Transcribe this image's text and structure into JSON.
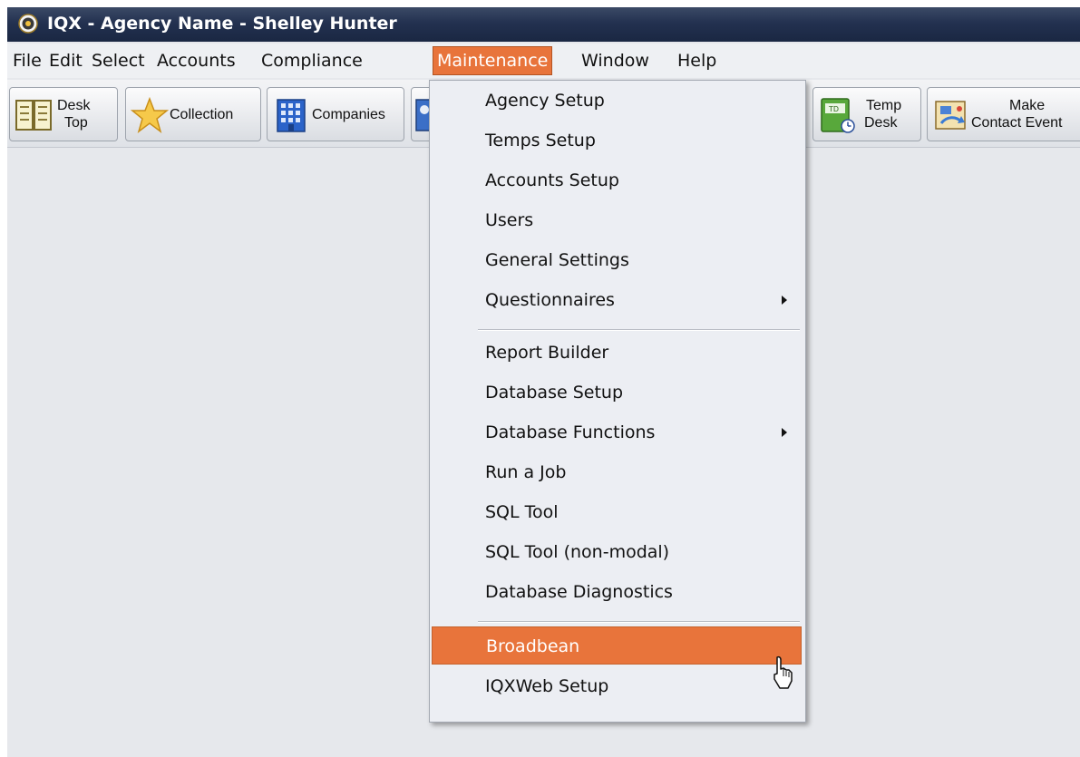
{
  "window": {
    "title": "IQX - Agency Name - Shelley Hunter"
  },
  "menubar": {
    "items": [
      "File",
      "Edit",
      "Select",
      "Accounts",
      "Compliance",
      "Maintenance",
      "Window",
      "Help"
    ],
    "active": "Maintenance"
  },
  "toolbar": {
    "desktop": {
      "line1": "Desk",
      "line2": "Top"
    },
    "collection": {
      "label": "Collection"
    },
    "companies": {
      "label": "Companies"
    },
    "temp_desk": {
      "line1": "Temp",
      "line2": "Desk",
      "icon_text": "TD"
    },
    "make_contact": {
      "line1": "Make",
      "line2": "Contact Event"
    }
  },
  "maintenance_menu": {
    "items": [
      {
        "label": "Agency Setup"
      },
      {
        "label": "Temps Setup"
      },
      {
        "label": "Accounts Setup"
      },
      {
        "label": "Users"
      },
      {
        "label": "General Settings"
      },
      {
        "label": "Questionnaires",
        "submenu": true
      },
      {
        "label": "Report Builder"
      },
      {
        "label": "Database Setup"
      },
      {
        "label": "Database Functions",
        "submenu": true
      },
      {
        "label": "Run a Job"
      },
      {
        "label": "SQL Tool"
      },
      {
        "label": "SQL Tool (non-modal)"
      },
      {
        "label": "Database Diagnostics"
      },
      {
        "label": "Broadbean",
        "selected": true
      },
      {
        "label": "IQXWeb Setup"
      }
    ]
  },
  "colors": {
    "accent": "#e8743b",
    "titlebar": "#233150",
    "menu_background": "#eceef3",
    "workspace": "#e6e8ec"
  }
}
